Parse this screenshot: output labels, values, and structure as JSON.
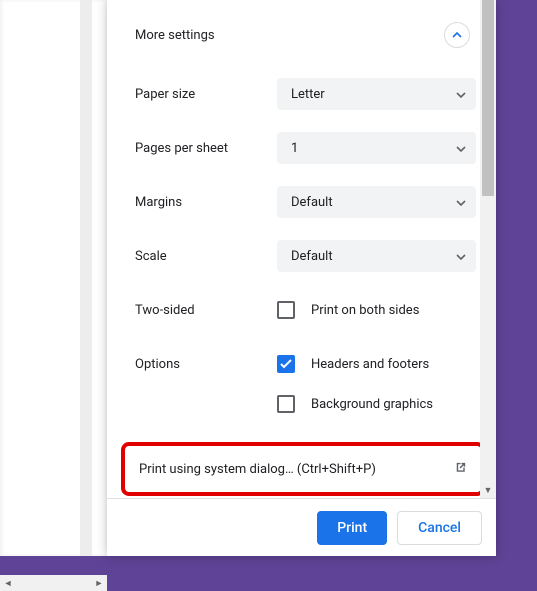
{
  "moreSettings": {
    "title": "More settings"
  },
  "rows": {
    "paperSize": {
      "label": "Paper size",
      "value": "Letter"
    },
    "pagesPerSheet": {
      "label": "Pages per sheet",
      "value": "1"
    },
    "margins": {
      "label": "Margins",
      "value": "Default"
    },
    "scaleRow": {
      "label": "Scale",
      "value": "Default"
    },
    "twoSided": {
      "label": "Two-sided",
      "checkbox": "Print on both sides",
      "checked": false
    },
    "optionsLabel": "Options",
    "headersFooters": {
      "checkbox": "Headers and footers",
      "checked": true
    },
    "backgroundGraphics": {
      "checkbox": "Background graphics",
      "checked": false
    }
  },
  "systemDialog": {
    "text": "Print using system dialog… (Ctrl+Shift+P)"
  },
  "footer": {
    "print": "Print",
    "cancel": "Cancel"
  }
}
